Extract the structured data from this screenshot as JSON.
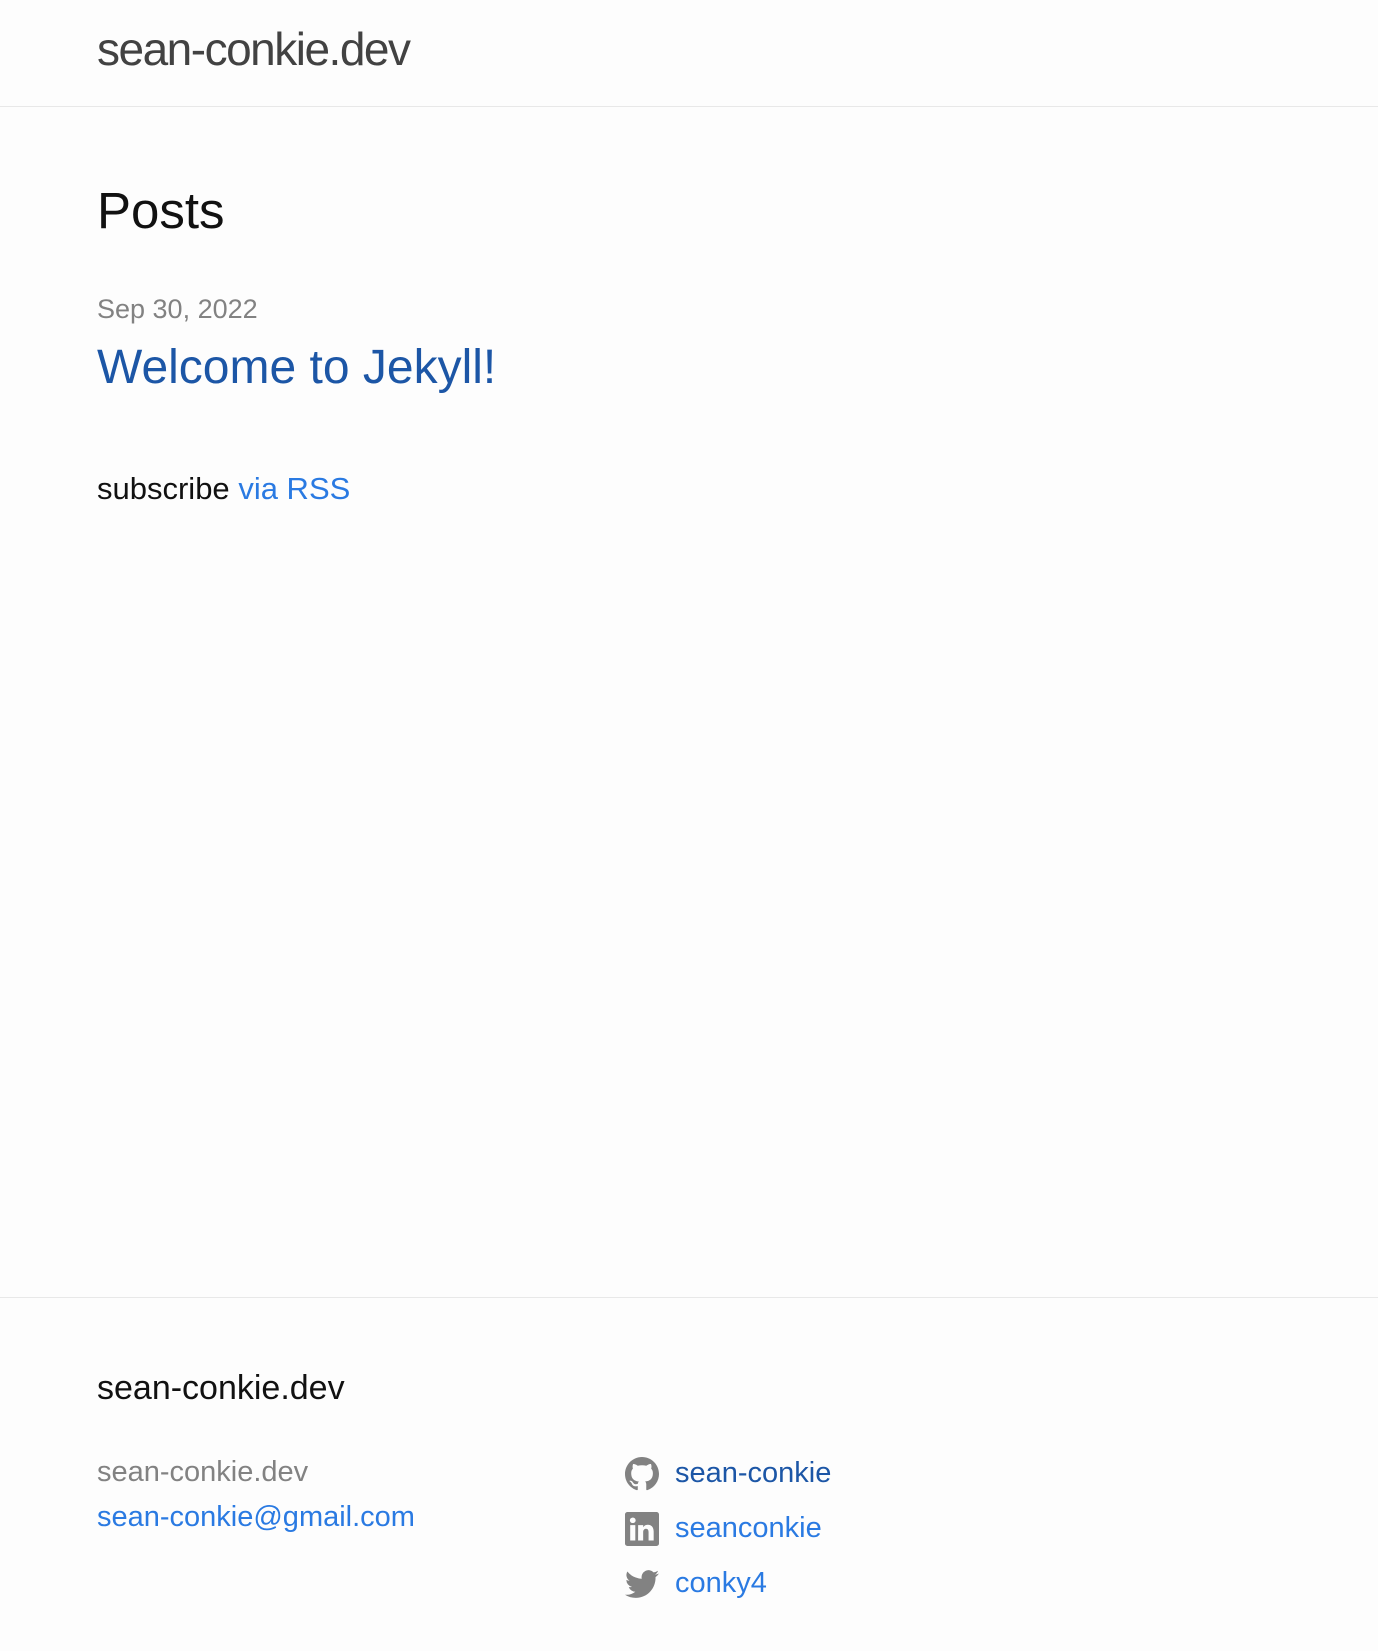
{
  "header": {
    "site_title": "sean-conkie.dev"
  },
  "main": {
    "page_heading": "Posts",
    "posts": [
      {
        "date": "Sep 30, 2022",
        "title": "Welcome to Jekyll!"
      }
    ],
    "rss": {
      "prefix": "subscribe",
      "link_label": "via RSS"
    }
  },
  "footer": {
    "heading": "sean-conkie.dev",
    "name": "sean-conkie.dev",
    "email": "sean-conkie@gmail.com",
    "social": [
      {
        "icon": "github-icon",
        "label": "sean-conkie"
      },
      {
        "icon": "linkedin-icon",
        "label": "seanconkie"
      },
      {
        "icon": "twitter-icon",
        "label": "conky4"
      }
    ]
  },
  "colors": {
    "link": "#2a7ae2",
    "visited_link": "#1c56a6",
    "muted_text": "#828282",
    "border": "#e8e8e8",
    "background": "#fdfdfd"
  }
}
